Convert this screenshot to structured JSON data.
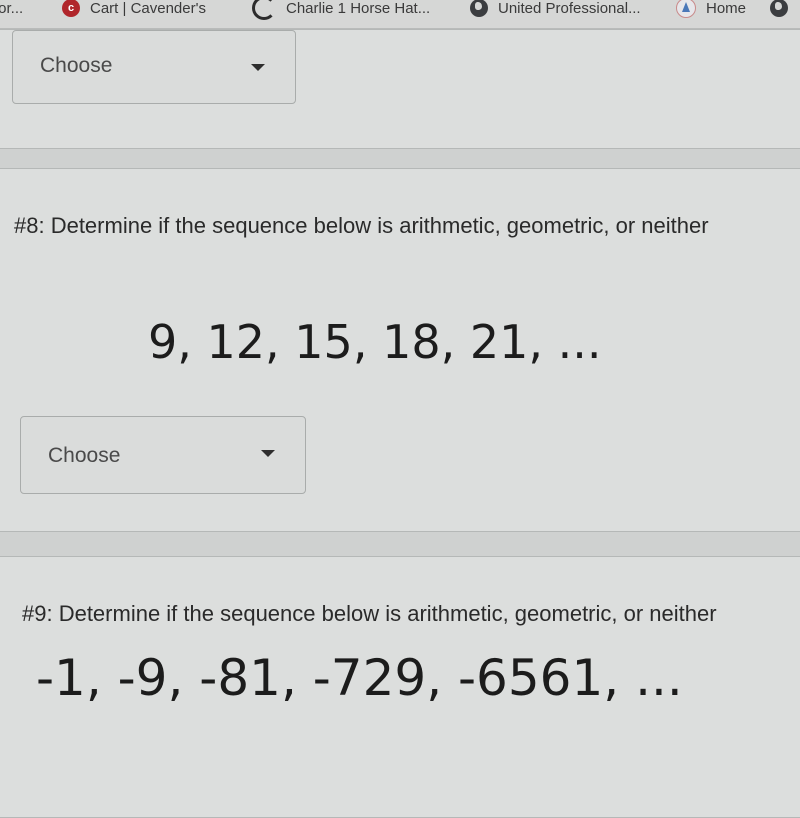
{
  "bookmarks": [
    {
      "label": "for...",
      "icon": "truncated"
    },
    {
      "label": "Cart | Cavender's",
      "icon": "cavenders-shield-icon"
    },
    {
      "label": "Charlie 1 Horse Hat...",
      "icon": "refresh-arrow-icon"
    },
    {
      "label": "United Professional...",
      "icon": "globe-icon"
    },
    {
      "label": "Home",
      "icon": "home-sail-icon"
    },
    {
      "label": "",
      "icon": "globe-icon"
    }
  ],
  "questions": [
    {
      "id": "prev",
      "select": {
        "value": "Choose"
      }
    },
    {
      "id": "8",
      "prompt": "#8: Determine if the sequence below is arithmetic, geometric, or neither",
      "sequence": "9, 12, 15, 18, 21, ...",
      "select": {
        "value": "Choose"
      }
    },
    {
      "id": "9",
      "prompt": "#9: Determine if the sequence below is arithmetic, geometric, or neither",
      "sequence": "-1, -9, -81, -729, -6561, ..."
    }
  ]
}
